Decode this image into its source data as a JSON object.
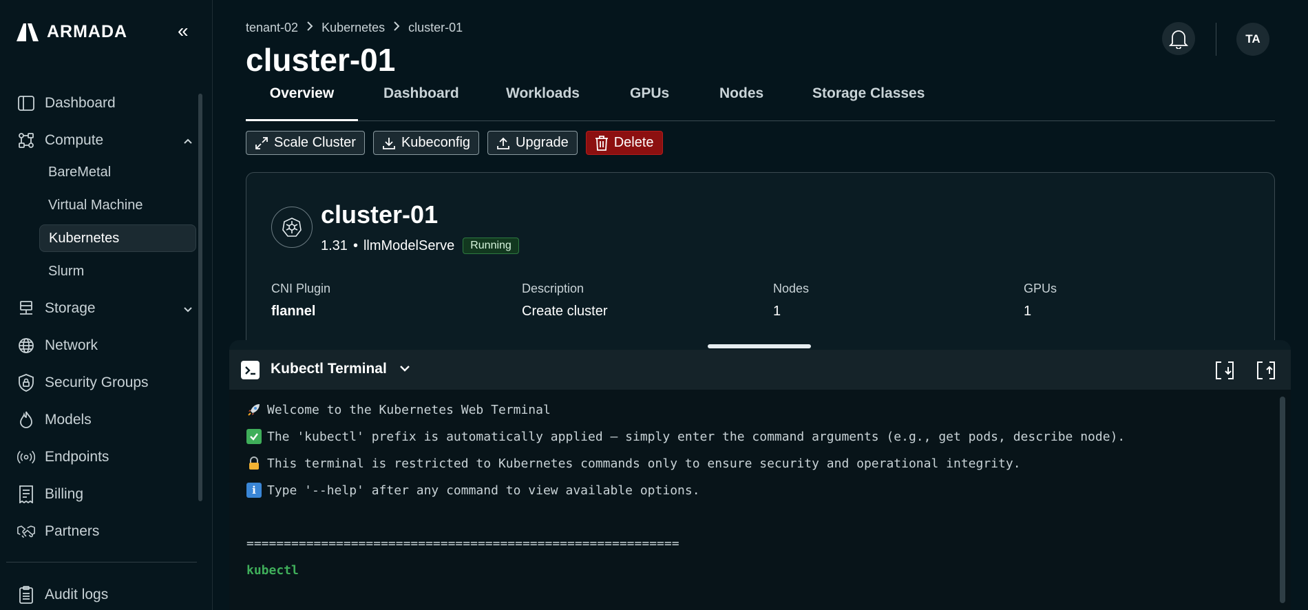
{
  "app": {
    "logo_text": "ARMADA",
    "collapse_label": "«"
  },
  "sidebar": {
    "items": [
      {
        "label": "Dashboard",
        "icon": "sidebar-panel-icon"
      },
      {
        "label": "Compute",
        "icon": "compute-icon",
        "expanded": true
      },
      {
        "label": "Storage",
        "icon": "storage-icon",
        "expanded": false
      },
      {
        "label": "Network",
        "icon": "globe-icon"
      },
      {
        "label": "Security Groups",
        "icon": "shield-lock-icon"
      },
      {
        "label": "Models",
        "icon": "flame-icon"
      },
      {
        "label": "Endpoints",
        "icon": "broadcast-icon"
      },
      {
        "label": "Billing",
        "icon": "receipt-icon"
      },
      {
        "label": "Partners",
        "icon": "handshake-icon"
      },
      {
        "label": "Audit logs",
        "icon": "clipboard-icon"
      }
    ],
    "compute_sub": [
      "BareMetal",
      "Virtual Machine",
      "Kubernetes",
      "Slurm"
    ],
    "active_sub": "Kubernetes"
  },
  "header": {
    "breadcrumb": [
      "tenant-02",
      "Kubernetes",
      "cluster-01"
    ],
    "title": "cluster-01",
    "avatar_initials": "TA"
  },
  "tabs": [
    "Overview",
    "Dashboard",
    "Workloads",
    "GPUs",
    "Nodes",
    "Storage Classes"
  ],
  "active_tab": "Overview",
  "actions": {
    "scale": "Scale Cluster",
    "kubeconfig": "Kubeconfig",
    "upgrade": "Upgrade",
    "delete": "Delete"
  },
  "cluster": {
    "name": "cluster-01",
    "version": "1.31",
    "dot": "•",
    "model": "llmModelServe",
    "status": "Running",
    "fields": [
      {
        "label": "CNI Plugin",
        "value": "flannel"
      },
      {
        "label": "Description",
        "value": "Create cluster"
      },
      {
        "label": "Nodes",
        "value": "1"
      },
      {
        "label": "GPUs",
        "value": "1"
      }
    ]
  },
  "terminal": {
    "title": "Kubectl Terminal",
    "lines": [
      {
        "emoji": "🚀",
        "text": "Welcome to the Kubernetes Web Terminal"
      },
      {
        "emoji": "✅",
        "text": "The 'kubectl' prefix is automatically applied — simply enter the command arguments (e.g., get pods, describe node)."
      },
      {
        "emoji": "🔒",
        "text": "This terminal is restricted to Kubernetes commands only to ensure security and operational integrity."
      },
      {
        "emoji": "ℹ️",
        "text": "Type '--help' after any command to view available options."
      }
    ],
    "separator": "==========================================================",
    "prompt": "kubectl"
  },
  "colors": {
    "accent_green": "#3fae5a",
    "danger": "#8c1010",
    "background": "#05151c"
  }
}
